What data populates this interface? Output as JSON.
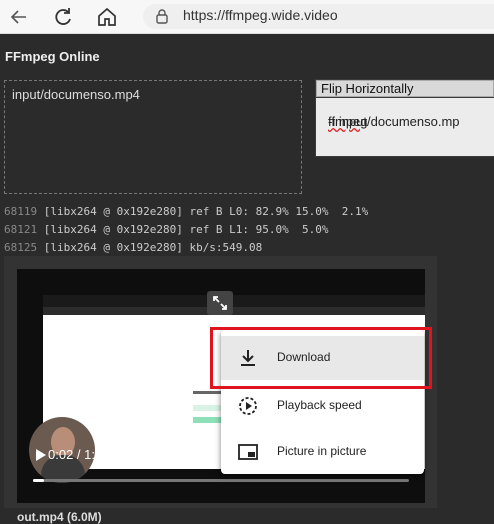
{
  "browser": {
    "url": "https://ffmpeg.wide.video"
  },
  "app": {
    "title": "FFmpeg Online",
    "input_file": "input/documenso.mp4",
    "command_title": "Flip Horizontally",
    "command_prefix": "ffmpeg",
    "command_rest": " -i input/documenso.mp",
    "log": [
      {
        "n": "68119",
        "text": " [libx264 @ 0x192e280] ref B L0: 82.9% 15.0%  2.1%"
      },
      {
        "n": "68121",
        "text": " [libx264 @ 0x192e280] ref B L1: 95.0%  5.0%"
      },
      {
        "n": "68125",
        "text": " [libx264 @ 0x192e280] kb/s:549.08"
      }
    ],
    "output_label": "out.mp4 (6.0M)"
  },
  "video": {
    "time": "0:02 / 1:13",
    "progress": 0.03
  },
  "menu": {
    "download": "Download",
    "speed": "Playback speed",
    "pip": "Picture in picture"
  }
}
